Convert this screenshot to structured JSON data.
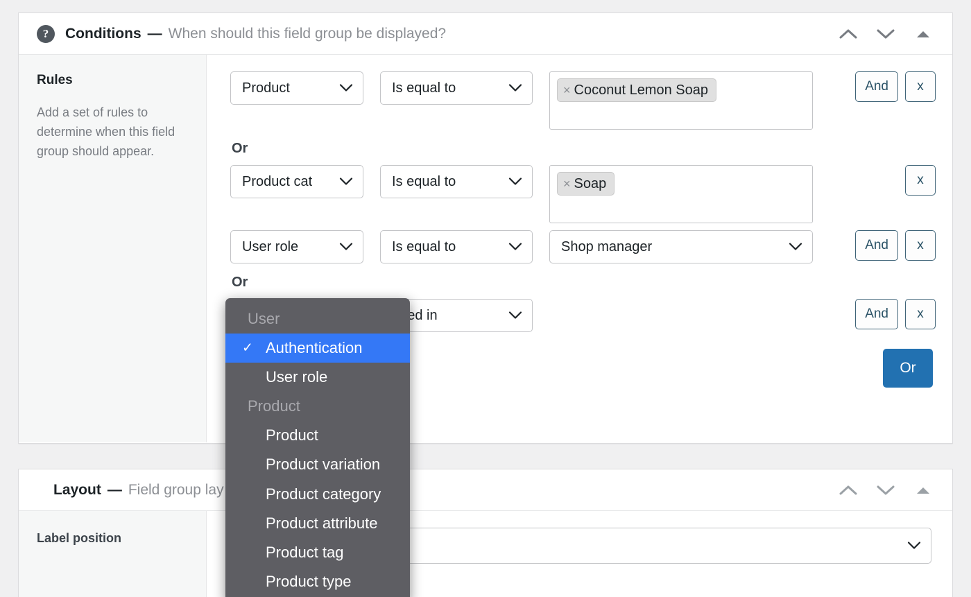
{
  "conditions_panel": {
    "help_icon": "question-mark-circle-icon",
    "title": "Conditions",
    "dash": "—",
    "subtitle": "When should this field group be displayed?",
    "header_buttons": [
      {
        "name": "move-up",
        "glyph": "chevron-up-icon"
      },
      {
        "name": "move-down",
        "glyph": "chevron-down-icon"
      },
      {
        "name": "collapse",
        "glyph": "triangle-up-icon"
      }
    ],
    "sidebar": {
      "title": "Rules",
      "description": "Add a set of rules to determine when this field group should appear."
    },
    "or_separator": "Or",
    "and_label": "And",
    "remove_label": "x",
    "or_button_label": "Or",
    "rules": [
      {
        "field": "Product",
        "operator": "Is equal to",
        "value_type": "tags",
        "tags": [
          {
            "label": "Coconut Lemon Soap",
            "remove": "×"
          }
        ],
        "has_and": true,
        "has_remove": true
      },
      {
        "field": "Product cat",
        "operator": "Is equal to",
        "value_type": "tags",
        "tags": [
          {
            "label": "Soap",
            "remove": "×"
          }
        ],
        "has_and": false,
        "has_remove": true
      },
      {
        "field": "User role",
        "operator": "Is equal to",
        "value_type": "select",
        "value": "Shop manager",
        "has_and": true,
        "has_remove": true
      },
      {
        "field": "",
        "operator": "",
        "value_type": "select",
        "value": "gged in",
        "has_and": true,
        "has_remove": true
      }
    ]
  },
  "dropdown": {
    "name": "field-type-dropdown",
    "selected": "Authentication",
    "checkmark": "✓",
    "entries": [
      {
        "type": "group",
        "label": "User"
      },
      {
        "type": "item",
        "label": "Authentication",
        "selected": true
      },
      {
        "type": "item",
        "label": "User role",
        "selected": false
      },
      {
        "type": "group",
        "label": "Product"
      },
      {
        "type": "item",
        "label": "Product",
        "selected": false
      },
      {
        "type": "item",
        "label": "Product variation",
        "selected": false
      },
      {
        "type": "item",
        "label": "Product category",
        "selected": false
      },
      {
        "type": "item",
        "label": "Product attribute",
        "selected": false
      },
      {
        "type": "item",
        "label": "Product tag",
        "selected": false
      },
      {
        "type": "item",
        "label": "Product type",
        "selected": false
      }
    ]
  },
  "layout_panel": {
    "title": "Layout",
    "dash": "—",
    "subtitle": "Field group lay",
    "header_buttons": [
      {
        "name": "move-up",
        "glyph": "chevron-up-icon"
      },
      {
        "name": "move-down",
        "glyph": "chevron-down-icon"
      },
      {
        "name": "collapse",
        "glyph": "triangle-up-icon"
      }
    ],
    "label_position": "Label position",
    "label_position_value": ""
  },
  "colors": {
    "accent_blue": "#2271b1",
    "highlight_blue": "#3478f6",
    "outline_teal": "#3f6478",
    "dropdown_bg": "#5e5e63",
    "panel_bg": "#ffffff",
    "sidebar_bg": "#f6f7f7",
    "page_bg": "#f0f0f1"
  }
}
